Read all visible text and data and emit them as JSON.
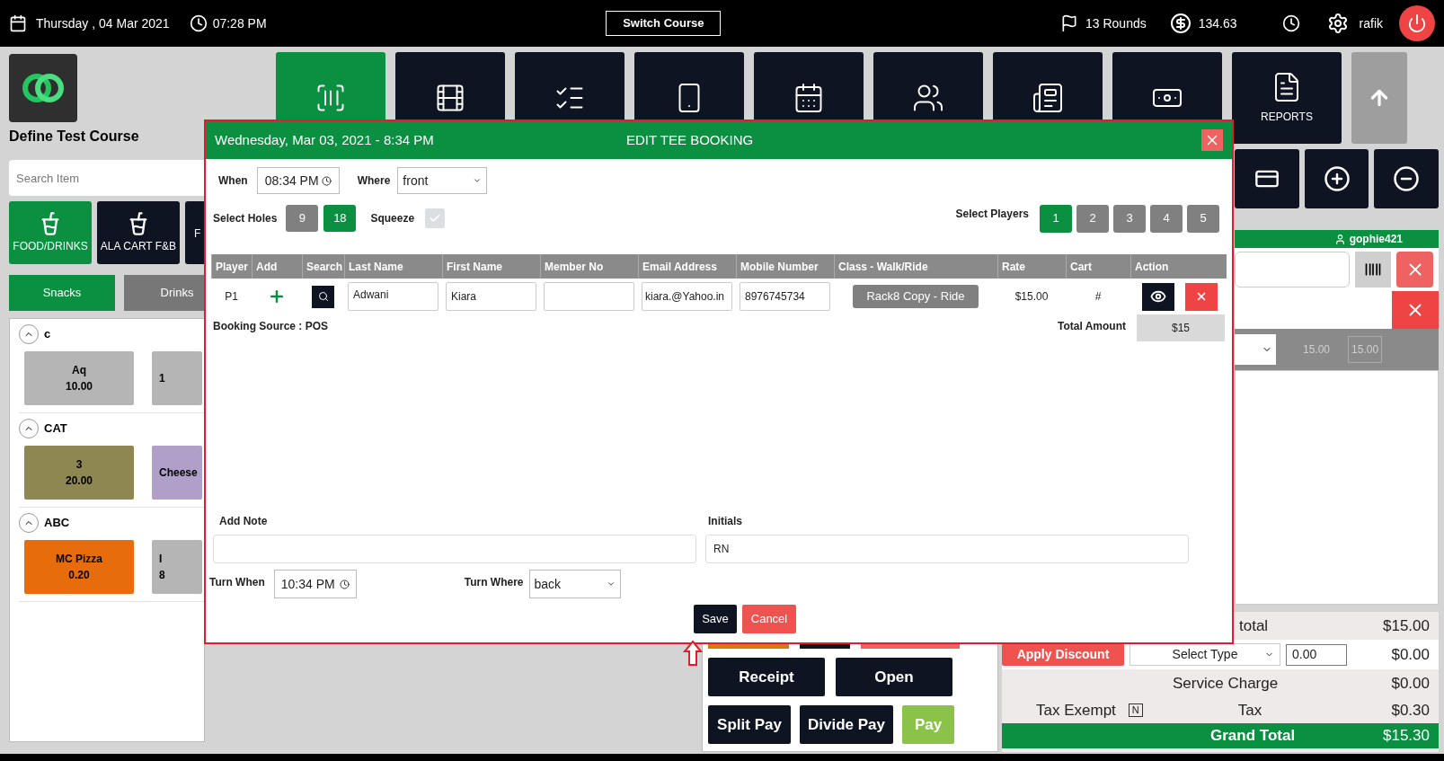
{
  "top_bar": {
    "date": "Thursday , 04 Mar 2021",
    "time": "07:28 PM",
    "switch_course": "Switch Course",
    "rounds": "13 Rounds",
    "balance": "134.63",
    "user": "rafik"
  },
  "tiles": [
    {
      "selected": true
    },
    {
      "selected": false
    },
    {
      "selected": false
    },
    {
      "selected": false
    },
    {
      "selected": false
    },
    {
      "selected": false
    },
    {
      "selected": false
    },
    {
      "selected": false
    },
    {
      "selected": false,
      "label": "REPORTS"
    }
  ],
  "sidebar": {
    "course": "Define Test Course",
    "search": {
      "placeholder": "Search Item"
    },
    "categories": [
      {
        "label": "FOOD/DRINKS",
        "selected": true
      },
      {
        "label": "ALA CART F&B",
        "selected": false
      },
      {
        "label": "F",
        "selected": false
      }
    ],
    "subtabs": [
      {
        "label": "Snacks",
        "selected": true
      },
      {
        "label": "Drinks",
        "selected": false
      }
    ],
    "sections": [
      {
        "title": "c",
        "items": [
          {
            "name": "Aq",
            "price": "10.00",
            "color": "#b5b5b5"
          },
          {
            "price": "1",
            "color": "#b5b5b5"
          }
        ]
      },
      {
        "title": "CAT",
        "items": [
          {
            "name": "3",
            "price": "20.00",
            "color": "#8f8752"
          },
          {
            "name": "Cheese",
            "color": "#b09fc8"
          }
        ]
      },
      {
        "title": "ABC",
        "items": [
          {
            "name": "MC Pizza",
            "price": "0.20",
            "color": "#e66c0c"
          },
          {
            "name": "I",
            "price": "8",
            "color": "#b5b5b5"
          }
        ]
      }
    ]
  },
  "right_panel": {
    "customer": "gophie421",
    "line_qty": "15.00",
    "line_total": "15.00"
  },
  "actions": [
    "Receipt",
    "Open",
    "Split Pay",
    "Divide Pay",
    "Pay"
  ],
  "totals": {
    "subtotal_label": "total",
    "subtotal": "$15.00",
    "apply_discount": "Apply Discount",
    "discount_type": "Select Type",
    "discount_value": "0.00",
    "discount": "$0.00",
    "service_label": "Service Charge",
    "service": "$0.00",
    "tax_exempt_label": "Tax Exempt",
    "tax_exempt_value": "N",
    "tax_label": "Tax",
    "tax": "$0.30",
    "grand_label": "Grand Total",
    "grand": "$15.30"
  },
  "dialog": {
    "date": "Wednesday, Mar 03, 2021 - 8:34 PM",
    "title": "EDIT TEE BOOKING",
    "when": {
      "label": "When",
      "value": "08:34 PM"
    },
    "where": {
      "label": "Where",
      "value": "front"
    },
    "holes": {
      "label": "Select Holes",
      "options": [
        {
          "label": "9",
          "selected": false
        },
        {
          "label": "18",
          "selected": true
        }
      ]
    },
    "squeeze": {
      "label": "Squeeze",
      "checked": true
    },
    "players": {
      "label": "Select Players",
      "options": [
        {
          "label": "1",
          "selected": true
        },
        {
          "label": "2",
          "selected": false
        },
        {
          "label": "3",
          "selected": false
        },
        {
          "label": "4",
          "selected": false
        },
        {
          "label": "5",
          "selected": false
        }
      ]
    },
    "columns": [
      "Player",
      "Add",
      "Search",
      "Last Name",
      "First Name",
      "Member No",
      "Email Address",
      "Mobile Number",
      "Class - Walk/Ride",
      "Rate",
      "Cart",
      "Action"
    ],
    "rows": [
      {
        "player": "P1",
        "last_name": "Adwani",
        "first_name": "Kiara",
        "email": "kiara.@Yahoo.in",
        "mobile": "8976745734",
        "class": "Rack8 Copy - Ride",
        "rate": "$15.00",
        "cart": "#"
      }
    ],
    "booking_source": "Booking Source : POS",
    "total_label": "Total Amount",
    "total": "$15",
    "note": {
      "label": "Add Note"
    },
    "initials": {
      "label": "Initials",
      "value": "RN"
    },
    "turn_when": {
      "label": "Turn When",
      "value": "10:34 PM"
    },
    "turn_where": {
      "label": "Turn Where",
      "value": "back"
    },
    "save": "Save",
    "cancel": "Cancel"
  }
}
